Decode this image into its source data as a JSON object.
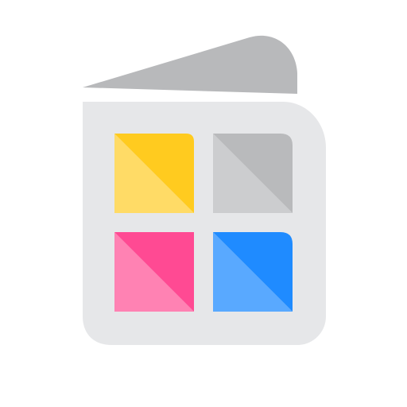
{
  "app": {
    "icon": "gallery-book-icon",
    "colors": {
      "background": "#ffffff",
      "cover_top": "#b8b9bb",
      "cover_body": "#e6e7e9",
      "tiles": {
        "yellow": {
          "dark": "#ffcb1f",
          "light": "#ffdb66"
        },
        "gray": {
          "dark": "#b9babc",
          "light": "#cccdcf"
        },
        "pink": {
          "dark": "#ff4a93",
          "light": "#ff82b3"
        },
        "blue": {
          "dark": "#1f8bff",
          "light": "#59a9ff"
        }
      }
    }
  }
}
